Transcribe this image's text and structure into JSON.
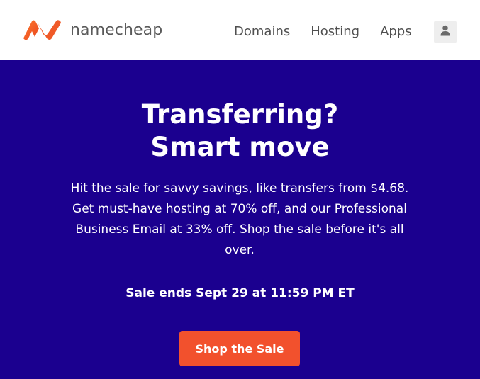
{
  "header": {
    "brand": "namecheap",
    "brand_color": "#f05a28",
    "nav": [
      "Domains",
      "Hosting",
      "Apps"
    ],
    "user_icon": "user-icon"
  },
  "hero": {
    "title_line1": "Transferring?",
    "title_line2": "Smart move",
    "description": "Hit the sale for savvy savings, like transfers from $4.68. Get must-have hosting at 70% off, and our Professional Business Email at 33% off. Shop the sale before it's all over.",
    "sale_ends": "Sale ends Sept 29 at 11:59 PM ET",
    "cta_label": "Shop the Sale",
    "background_color": "#1b008f",
    "cta_color": "#f2512d"
  }
}
